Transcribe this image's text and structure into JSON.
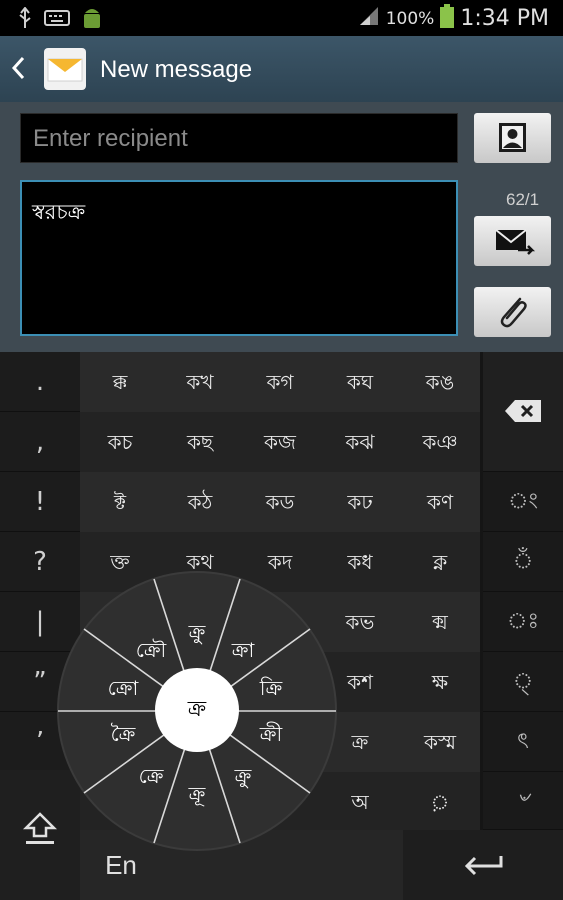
{
  "status_bar": {
    "battery_percent": "100%",
    "time": "1:34 PM",
    "icons": [
      "usb-icon",
      "keyboard-icon",
      "android-icon",
      "signal-icon",
      "battery-icon"
    ]
  },
  "action_bar": {
    "title": "New message",
    "icons": [
      "back-icon",
      "message-app-icon"
    ]
  },
  "compose": {
    "recipient_placeholder": "Enter recipient",
    "message_text": "স্বরচক্র",
    "counter": "62/1",
    "icons": [
      "contact-icon",
      "send-icon",
      "attach-icon"
    ]
  },
  "keyboard": {
    "left_column": [
      ".",
      ",",
      "!",
      "?",
      "|",
      "”",
      "’"
    ],
    "grid": [
      [
        "ক্ক",
        "কখ",
        "কগ",
        "কঘ",
        "কঙ"
      ],
      [
        "কচ",
        "কছ",
        "কজ",
        "কঝ",
        "কঞ"
      ],
      [
        "ক্ট",
        "কঠ",
        "কড",
        "কঢ",
        "কণ"
      ],
      [
        "ক্ত",
        "কথ",
        "কদ",
        "কধ",
        "ক্ন"
      ],
      [
        "",
        "",
        "",
        "কভ",
        "ক্ম"
      ],
      [
        "",
        "",
        "",
        "কশ",
        "ক্ষ"
      ],
      [
        "",
        "",
        "",
        "ক্র",
        "কস্ম"
      ],
      [
        "",
        "",
        "",
        "অ",
        "়"
      ]
    ],
    "right_column": [
      "ং",
      "ঁ",
      "ঃ",
      "্",
      "ৎ",
      "৺"
    ],
    "language_key": "En",
    "wheel": {
      "center": "ক্র",
      "segments": [
        "ক্রু",
        "ক্রা",
        "ক্রি",
        "ক্রী",
        "ক্রু",
        "ক্রূ",
        "ক্রে",
        "ক্রৈ",
        "ক্রো",
        "ক্রৌ"
      ]
    },
    "icons": [
      "backspace-icon",
      "shift-icon",
      "enter-icon"
    ]
  }
}
